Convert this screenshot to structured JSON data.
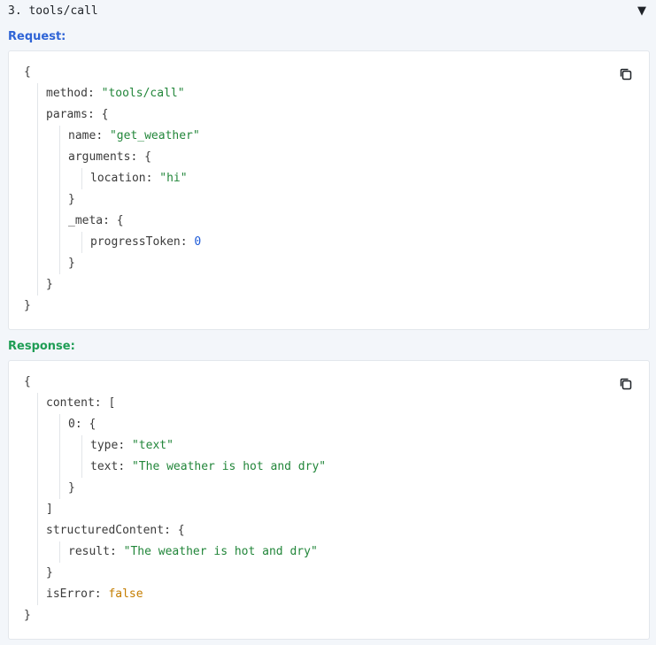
{
  "header": {
    "title": "3. tools/call",
    "toggle_icon": "▼"
  },
  "request": {
    "label": "Request:",
    "label_color": "#2f64d6",
    "lines": [
      {
        "k": "",
        "v": "{",
        "t": "punct"
      },
      {
        "k": "method",
        "v": "\"tools/call\"",
        "t": "str"
      },
      {
        "k": "params",
        "v": "{",
        "t": "punct"
      },
      {
        "k": "name",
        "v": "\"get_weather\"",
        "t": "str"
      },
      {
        "k": "arguments",
        "v": "{",
        "t": "punct"
      },
      {
        "k": "location",
        "v": "\"hi\"",
        "t": "str"
      },
      {
        "k": "",
        "v": "}",
        "t": "punct"
      },
      {
        "k": "_meta",
        "v": "{",
        "t": "punct"
      },
      {
        "k": "progressToken",
        "v": "0",
        "t": "num"
      },
      {
        "k": "",
        "v": "}",
        "t": "punct"
      },
      {
        "k": "",
        "v": "}",
        "t": "punct"
      },
      {
        "k": "",
        "v": "}",
        "t": "punct"
      }
    ]
  },
  "response": {
    "label": "Response:",
    "label_color": "#1f9d55",
    "lines": [
      {
        "k": "",
        "v": "{",
        "t": "punct"
      },
      {
        "k": "content",
        "v": "[",
        "t": "punct"
      },
      {
        "k": "0",
        "v": "{",
        "t": "punct"
      },
      {
        "k": "type",
        "v": "\"text\"",
        "t": "str"
      },
      {
        "k": "text",
        "v": "\"The weather is hot and dry\"",
        "t": "str"
      },
      {
        "k": "",
        "v": "}",
        "t": "punct"
      },
      {
        "k": "",
        "v": "]",
        "t": "punct"
      },
      {
        "k": "structuredContent",
        "v": "{",
        "t": "punct"
      },
      {
        "k": "result",
        "v": "\"The weather is hot and dry\"",
        "t": "str"
      },
      {
        "k": "",
        "v": "}",
        "t": "punct"
      },
      {
        "k": "isError",
        "v": "false",
        "t": "bool"
      },
      {
        "k": "",
        "v": "}",
        "t": "punct"
      }
    ]
  },
  "icons": {
    "copy": "copy-icon",
    "toggle": "triangle-down-icon"
  }
}
